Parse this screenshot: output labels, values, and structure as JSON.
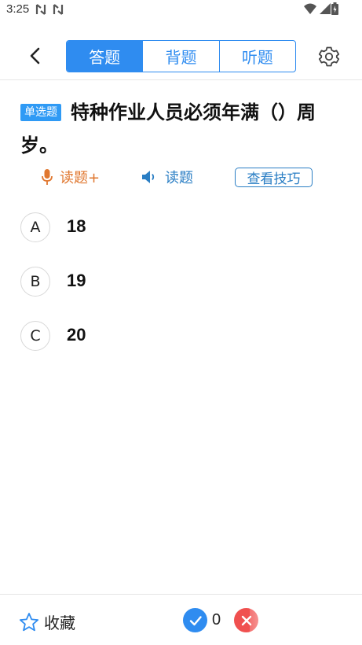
{
  "status_bar": {
    "time": "3:25"
  },
  "header": {
    "tabs": [
      {
        "label": "答题",
        "active": true
      },
      {
        "label": "背题",
        "active": false
      },
      {
        "label": "听题",
        "active": false
      }
    ]
  },
  "question": {
    "type_badge": "单选题",
    "text": "特种作业人员必须年满（）周岁。"
  },
  "actions": {
    "voice_read_label": "读题+",
    "listen_read_label": "读题",
    "tips_label": "查看技巧"
  },
  "options": [
    {
      "letter": "A",
      "text": "18"
    },
    {
      "letter": "B",
      "text": "19"
    },
    {
      "letter": "C",
      "text": "20"
    }
  ],
  "bottom_bar": {
    "favorite_label": "收藏",
    "correct_count": "0"
  },
  "colors": {
    "accent": "#2f8cf0",
    "voice_orange": "#e0772f",
    "wrong_red": "#f0504f"
  }
}
